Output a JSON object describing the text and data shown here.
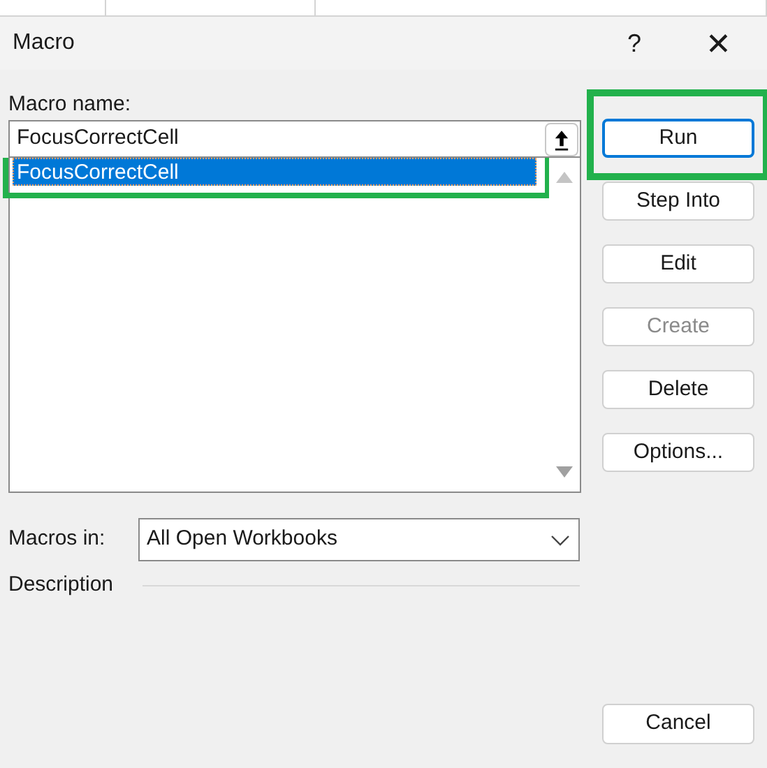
{
  "window": {
    "title": "Macro",
    "help": "?",
    "close": "✕"
  },
  "macro_name": {
    "label": "Macro name:",
    "value": "FocusCorrectCell"
  },
  "macro_list": [
    {
      "name": "FocusCorrectCell",
      "selected": true,
      "highlighted": true
    }
  ],
  "buttons": [
    {
      "label": "Run",
      "focused": true,
      "disabled": false,
      "highlighted": true
    },
    {
      "label": "Step Into",
      "focused": false,
      "disabled": false,
      "highlighted": false
    },
    {
      "label": "Edit",
      "focused": false,
      "disabled": false,
      "highlighted": false
    },
    {
      "label": "Create",
      "focused": false,
      "disabled": true,
      "highlighted": false
    },
    {
      "label": "Delete",
      "focused": false,
      "disabled": false,
      "highlighted": false
    },
    {
      "label": "Options...",
      "focused": false,
      "disabled": false,
      "highlighted": false
    }
  ],
  "macros_in": {
    "label": "Macros in:",
    "value": "All Open Workbooks"
  },
  "description": {
    "label": "Description"
  },
  "cancel": {
    "label": "Cancel"
  }
}
